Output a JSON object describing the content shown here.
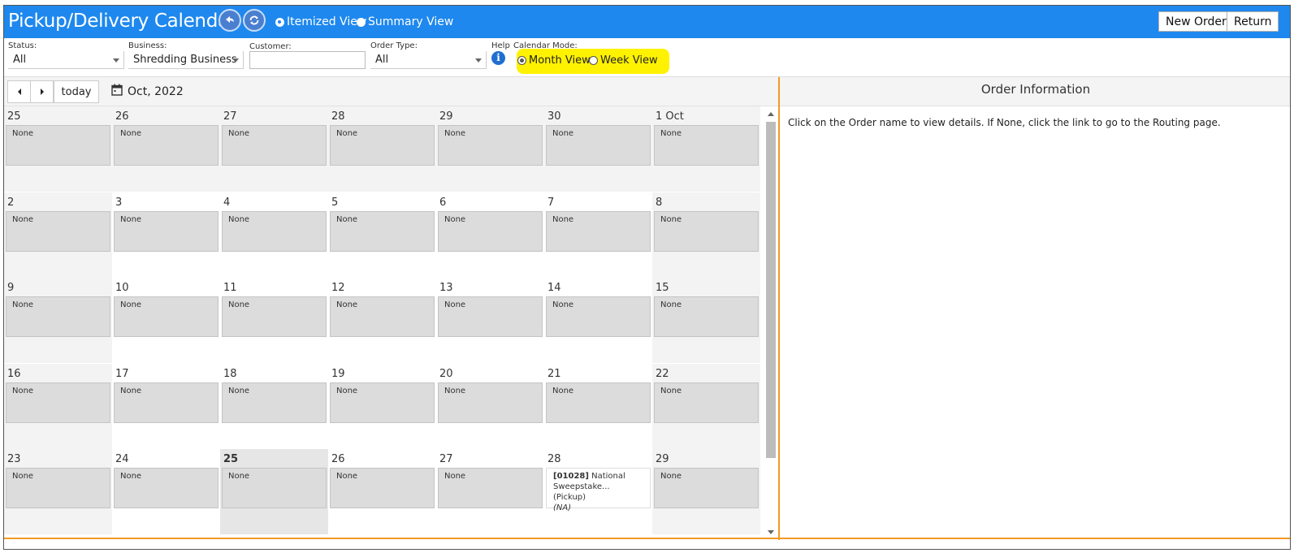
{
  "header": {
    "title": "Pickup/Delivery Calendar",
    "back_icon": "back-arrow-icon",
    "refresh_icon": "refresh-icon",
    "views": [
      {
        "label": "Itemized View",
        "selected": true
      },
      {
        "label": "Summary View",
        "selected": false
      }
    ],
    "new_order_label": "New Order",
    "return_label": "Return",
    "bar_color": "#1e88ee"
  },
  "filters": {
    "status": {
      "label": "Status:",
      "value": "All"
    },
    "business": {
      "label": "Business:",
      "value": "Shredding Business"
    },
    "customer": {
      "label": "Customer:",
      "value": ""
    },
    "order_type": {
      "label": "Order Type:",
      "value": "All"
    },
    "help_label": "Help",
    "help_icon": "info-icon",
    "calendar_mode": {
      "label": "Calendar Mode:",
      "options": [
        {
          "label": "Month View",
          "selected": true
        },
        {
          "label": "Week View",
          "selected": false
        }
      ],
      "highlight_color": "#fff200"
    }
  },
  "calendar": {
    "today_label": "today",
    "prev_icon": "caret-left-icon",
    "next_icon": "caret-right-icon",
    "calendar_icon": "calendar-icon",
    "month_label": "Oct, 2022",
    "none_label": "None",
    "weeks": [
      [
        "25",
        "26",
        "27",
        "28",
        "29",
        "30",
        "1 Oct"
      ],
      [
        "2",
        "3",
        "4",
        "5",
        "6",
        "7",
        "8"
      ],
      [
        "9",
        "10",
        "11",
        "12",
        "13",
        "14",
        "15"
      ],
      [
        "16",
        "17",
        "18",
        "19",
        "20",
        "21",
        "22"
      ],
      [
        "23",
        "24",
        "25",
        "26",
        "27",
        "28",
        "29"
      ]
    ],
    "today_cell": {
      "week": 4,
      "day": 2
    },
    "order_event": {
      "week": 4,
      "day": 5,
      "id": "[01028]",
      "line1": " National",
      "line2": "Sweepstake... (Pickup)",
      "line3": "(NA)"
    }
  },
  "panel": {
    "title": "Order Information",
    "text": "Click on the Order name to view details. If None, click the link to go to the Routing page."
  },
  "accent_color": "#f29a25"
}
